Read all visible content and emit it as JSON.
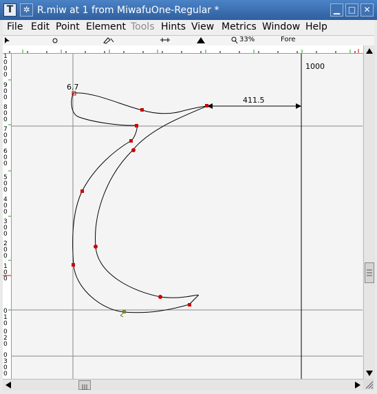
{
  "window": {
    "title": "R.miw at 1 from MiwafuOne-Regular *",
    "app_icon_glyph": "T",
    "sys_glyph": "✲",
    "minimize_glyph": "▁",
    "maximize_glyph": "□",
    "close_glyph": "✕"
  },
  "menu": {
    "items": [
      {
        "label": "File"
      },
      {
        "label": "Edit"
      },
      {
        "label": "Point"
      },
      {
        "label": "Element"
      },
      {
        "label": "Tools"
      },
      {
        "label": "Hints"
      },
      {
        "label": "View"
      },
      {
        "label": "Metrics"
      },
      {
        "label": "Window"
      },
      {
        "label": "Help"
      }
    ]
  },
  "toolstrip": {
    "zoom": "33%",
    "layer": "Fore"
  },
  "canvas": {
    "advance_label": "1000",
    "point_label": "6.7",
    "measure_label": "411.5"
  },
  "vruler": {
    "digits": [
      "1",
      "0",
      "0",
      "0",
      "9",
      "0",
      "0",
      "8",
      "0",
      "0",
      "7",
      "0",
      "0",
      "6",
      "0",
      "0",
      "5",
      "0",
      "0",
      "4",
      "0",
      "0",
      "3",
      "0",
      "0",
      "2",
      "0",
      "0",
      "1",
      "0",
      "0",
      "0",
      "1",
      "0",
      "0",
      "2",
      "0",
      "0",
      "3",
      "0",
      "0"
    ]
  },
  "colors": {
    "accent": "#2f5f9f",
    "point": "#cc0000",
    "outline": "#000000"
  }
}
